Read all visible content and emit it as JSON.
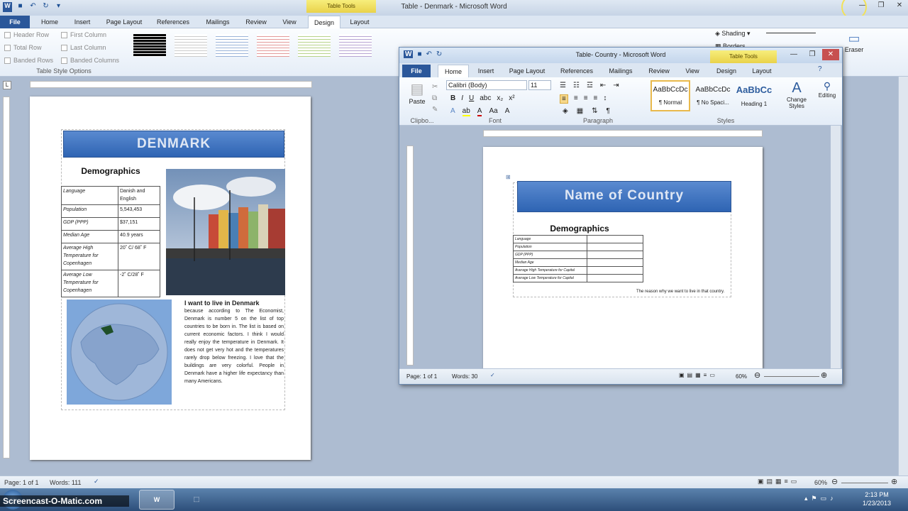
{
  "main_window": {
    "title": "Table - Denmark - Microsoft Word",
    "table_tools": "Table Tools",
    "tabs": [
      "File",
      "Home",
      "Insert",
      "Page Layout",
      "References",
      "Mailings",
      "Review",
      "View",
      "Design",
      "Layout"
    ],
    "style_options": [
      "Header Row",
      "First Column",
      "Total Row",
      "Last Column",
      "Banded Rows",
      "Banded Columns"
    ],
    "style_options_label": "Table Style Options",
    "shading": "Shading",
    "borders": "Borders",
    "eraser": "Eraser",
    "status": {
      "page": "Page: 1 of 1",
      "words": "Words: 111",
      "zoom": "60%"
    }
  },
  "doc": {
    "title": "DENMARK",
    "demographics": "Demographics",
    "rows": [
      [
        "Language",
        "Danish and English"
      ],
      [
        "Population",
        "5,543,453"
      ],
      [
        "GDP (PPP)",
        "$37,151"
      ],
      [
        "Median Age",
        "40.9 years"
      ],
      [
        "Average High Temperature for Copenhagen",
        "20˚ C/ 68˚ F"
      ],
      [
        "Average Low Temperature for Copenhagen",
        "-2˚ C/28˚ F"
      ]
    ],
    "reason_heading": "I want to live in Denmark",
    "reason_text": "because according to The Economist, Denmark is number 5 on the list of top countries to be born in. The list is based on current economic factors. I think I would really enjoy the temperature in Denmark. It does not get very hot and the temperatures rarely drop below freezing. I love that the buildings are very colorful. People in Denmark have a higher life expectancy than many Americans."
  },
  "inner_window": {
    "title": "Table- Country - Microsoft Word",
    "table_tools": "Table Tools",
    "tabs": [
      "File",
      "Home",
      "Insert",
      "Page Layout",
      "References",
      "Mailings",
      "Review",
      "View",
      "Design",
      "Layout"
    ],
    "font": "Calibri (Body)",
    "size": "11",
    "paste": "Paste",
    "groups": [
      "Clipbo...",
      "Font",
      "Paragraph",
      "Styles"
    ],
    "styles": [
      {
        "sample": "AaBbCcDc",
        "name": "¶ Normal"
      },
      {
        "sample": "AaBbCcDc",
        "name": "¶ No Spaci..."
      },
      {
        "sample": "AaBbCc",
        "name": "Heading 1"
      }
    ],
    "change_styles": "Change Styles",
    "editing": "Editing",
    "status": {
      "page": "Page: 1 of 1",
      "words": "Words: 30",
      "zoom": "60%"
    },
    "doc": {
      "title": "Name of Country",
      "demographics": "Demographics",
      "rows": [
        "Language",
        "Population",
        "GDP (PPP)",
        "Median Age",
        "Average High Temperature for Capital",
        "Average Low Temperature for Capital"
      ],
      "reason": "The reason why we want to live in that country."
    }
  },
  "taskbar": {
    "brand": "Screencast-O-Matic.com",
    "time": "2:13 PM",
    "date": "1/23/2013"
  }
}
